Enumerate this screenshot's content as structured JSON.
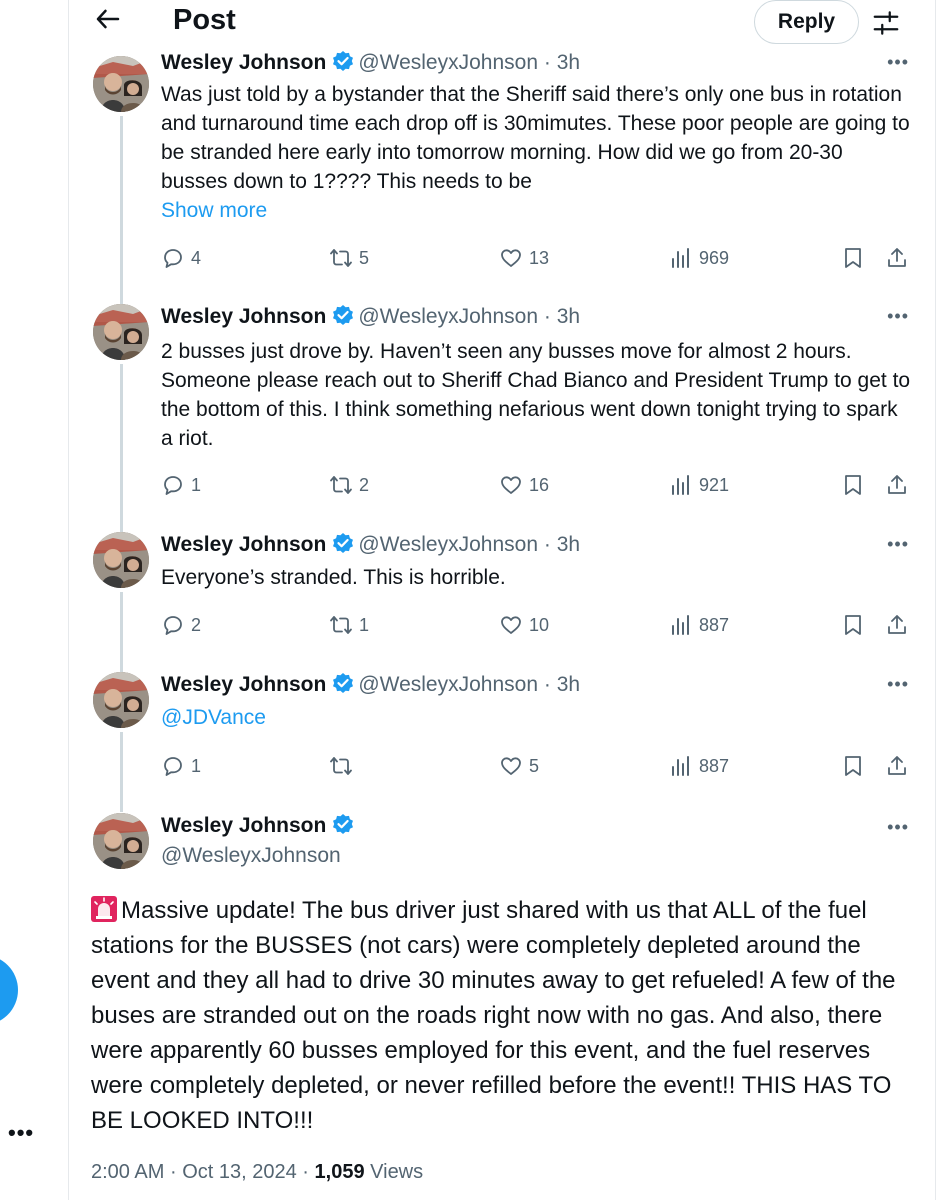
{
  "header": {
    "title": "Post",
    "reply_label": "Reply"
  },
  "icons": {
    "back": "arrow-left-icon",
    "settings": "sliders-icon",
    "verified": "verified-badge-icon",
    "comment": "comment-icon",
    "retweet": "retweet-icon",
    "like": "heart-icon",
    "views": "views-icon",
    "bookmark": "bookmark-icon",
    "share": "share-icon",
    "siren": "siren-emoji-icon"
  },
  "colors": {
    "accent": "#1d9bf0",
    "secondary_text": "#536471",
    "verified": "#1d9bf0",
    "siren": "#e0245e"
  },
  "rail": {
    "more_label": "•••"
  },
  "thread": [
    {
      "author": "Wesley Johnson",
      "handle": "@WesleyxJohnson",
      "time": "3h",
      "text": "Was just told by a bystander that the Sheriff said there’s only one bus in rotation and turnaround time each drop off is 30mimutes. These poor people are going to be stranded here early into tomorrow morning. How did we go from 20-30 busses down to 1???? This needs to be",
      "show_more": "Show more",
      "replies": "4",
      "reposts": "5",
      "likes": "13",
      "views": "969"
    },
    {
      "author": "Wesley Johnson",
      "handle": "@WesleyxJohnson",
      "time": "3h",
      "text": "2 busses just drove by. Haven’t seen any busses move for almost 2 hours. Someone please reach out to Sheriff Chad Bianco and President Trump to get to the bottom of this. I think something nefarious went down tonight trying to spark a riot.",
      "replies": "1",
      "reposts": "2",
      "likes": "16",
      "views": "921"
    },
    {
      "author": "Wesley Johnson",
      "handle": "@WesleyxJohnson",
      "time": "3h",
      "text": "Everyone’s stranded. This is horrible.",
      "replies": "2",
      "reposts": "1",
      "likes": "10",
      "views": "887"
    },
    {
      "author": "Wesley Johnson",
      "handle": "@WesleyxJohnson",
      "time": "3h",
      "mention": "@JDVance",
      "replies": "1",
      "reposts": "",
      "likes": "5",
      "views": "887"
    }
  ],
  "main_post": {
    "author": "Wesley Johnson",
    "handle": "@WesleyxJohnson",
    "text": "Massive update! The bus driver just shared with us that ALL of the fuel stations for the BUSSES (not cars) were completely depleted around the event and they all had to drive 30 minutes away to get refueled! A few of the buses are stranded out on the roads right now with no gas. And also, there were apparently 60 busses employed for this event, and the fuel reserves were completely depleted, or never refilled before the event!! THIS HAS TO BE LOOKED INTO!!!",
    "time": "2:00 AM",
    "date": "Oct 13, 2024",
    "views_count": "1,059",
    "views_label": "Views"
  },
  "separators": {
    "dot": "·",
    "more": "•••"
  }
}
